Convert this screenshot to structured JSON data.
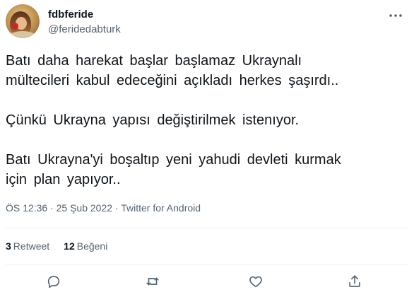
{
  "author": {
    "display_name": "fdbferide",
    "handle": "@feridedabturk"
  },
  "tweet": {
    "text": "Batı  daha  harekat  başlar  başlamaz  Ukraynalı\nmültecileri  kabul  edeceğini  açıkladı  herkes şaşırdı..\n\nÇünkü  Ukrayna  yapısı  değiştirilmek istenıyor.\n\nBatı  Ukrayna'yi  boşaltıp  yeni  yahudi  devleti kurmak\niçin  plan  yapıyor..",
    "time": "ÖS 12:36",
    "separator": "·",
    "date": "25 Şub 2022",
    "source": "Twitter for Android"
  },
  "stats": {
    "retweet_count": "3",
    "retweet_label": "Retweet",
    "like_count": "12",
    "like_label": "Beğeni"
  },
  "icons": {
    "more": "more-dots-icon",
    "reply": "reply-icon",
    "retweet": "retweet-icon",
    "like": "heart-icon",
    "share": "share-icon"
  },
  "colors": {
    "text": "#0f1419",
    "secondary": "#536471",
    "divider": "#eff3f4"
  }
}
